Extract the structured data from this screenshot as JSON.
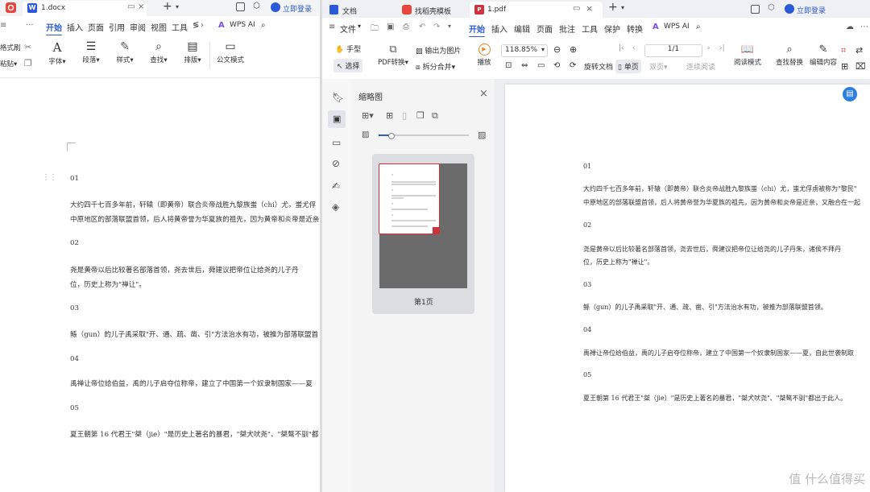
{
  "left_window": {
    "tab_title": "1.docx",
    "login_label": "立即登录",
    "menu": [
      "开始",
      "插入",
      "页面",
      "引用",
      "审阅",
      "视图",
      "工具"
    ],
    "menu_more": "≶",
    "wps_ai": "WPS AI",
    "ribbon": {
      "format_painter": "格式刷",
      "paste": "粘贴",
      "font": "字体",
      "paragraph": "段落",
      "style": "样式",
      "find": "查找",
      "layout": "排版",
      "official_doc": "公文模式"
    },
    "doc": {
      "h1": "01",
      "p1": "大约四千七百多年前，轩辕（即黄帝）联合炎帝战胜九黎族蚩（chi）尤，蚩尤俘",
      "p1b": "中原地区的部落联盟首领，后人将黄帝誉为华夏族的祖先，因为黄帝和炎帝是近亲",
      "h2": "02",
      "p2": "尧是黄帝以后比较著名部落首领，尧去世后，舜建议把帝位让给尧的儿子丹",
      "p2b": "位，历史上称为\"禅让\"。",
      "h3": "03",
      "p3": "鲧（gun）的儿子禹采取\"开、通、疏、凿、引\"方法治水有功，被推为部落联盟首",
      "h4": "04",
      "p4": "禹禅让帝位给伯益，禹的儿子启夺位称帝，建立了中国第一个奴隶制国家——夏",
      "h5": "05",
      "p5": "夏王朝第 16 代君王\"桀（jie）\"是历史上著名的暴君，\"桀犬吠尧\"、\"桀骜不驯\"都"
    }
  },
  "right_window": {
    "tabs": [
      "文档",
      "找稻壳模板",
      "1.pdf"
    ],
    "login_label": "立即登录",
    "file_menu": "文件",
    "menu": [
      "开始",
      "插入",
      "编辑",
      "页面",
      "批注",
      "工具",
      "保护",
      "转换"
    ],
    "wps_ai": "WPS AI",
    "ribbon": {
      "hand": "手型",
      "select": "选择",
      "pdf_convert": "PDF转换",
      "export_image": "输出为图片",
      "split_merge": "拆分合并",
      "play": "播放",
      "zoom": "118.85%",
      "page_indicator": "1/1",
      "rotate": "旋转文档",
      "single": "单页",
      "double": "双页",
      "continuous": "连续阅读",
      "read_mode": "阅读模式",
      "find_replace": "查找替换",
      "edit_content": "编辑内容"
    },
    "thumbnail_panel": {
      "title": "缩略图",
      "page_label": "第1页"
    },
    "pdf": {
      "h1": "01",
      "p1": "大约四千七百多年前，轩辕（即黄帝）联合炎帝战胜九黎族蚩（chi）尤，蚩尤俘虏被称为\"黎民\"",
      "p1b": "中原地区的部落联盟首领，后人将黄帝誉为华夏族的祖先，因为黄帝和炎帝是近亲，又融合在一起",
      "h2": "02",
      "p2": "尧是黄帝以后比较著名部落首领，尧去世后，舜建议把帝位让给尧的儿子丹朱，诸侯不拜丹",
      "p2b": "位，历史上称为\"禅让\"。",
      "h3": "03",
      "p3": "鲧（gun）的儿子禹采取\"开、通、疏、凿、引\"方法治水有功，被推为部落联盟首领。",
      "h4": "04",
      "p4": "禹禅让帝位给伯益，禹的儿子启夺位称帝，建立了中国第一个奴隶制国家——夏，自此世袭制取",
      "h5": "05",
      "p5": "夏王朝第 16 代君王\"桀（jie）\"是历史上著名的暴君，\"桀犬吠尧\"、\"桀骜不驯\"都出于此人。"
    }
  },
  "watermark": "值 什么值得买",
  "colors": {
    "accent": "#2b5ad8",
    "pdf_red": "#d1313b",
    "thumb_gray": "#6b6b6b"
  }
}
